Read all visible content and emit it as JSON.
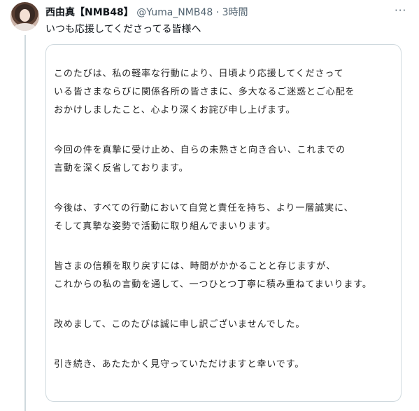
{
  "post": {
    "display_name": "西由真【NMB48】",
    "handle": "@Yuma_NMB48",
    "separator": "·",
    "time": "3時間",
    "text": "いつも応援してくださってる皆様へ",
    "more_icon": "more-horizontal-icon"
  },
  "letter": {
    "paragraphs": [
      [
        "このたびは、私の軽率な行動により、日頃より応援してくださって",
        "いる皆さまならびに関係各所の皆さまに、多大なるご迷惑とご心配を",
        "おかけしましたこと、心より深くお詫び申し上げます。"
      ],
      [
        "今回の件を真摯に受け止め、自らの未熟さと向き合い、これまでの",
        "言動を深く反省しております。"
      ],
      [
        "今後は、すべての行動において自覚と責任を持ち、より一層誠実に、",
        "そして真摯な姿勢で活動に取り組んでまいります。"
      ],
      [
        "皆さまの信頼を取り戻すには、時間がかかることと存じますが、",
        "これからの私の言動を通して、一つひとつ丁寧に積み重ねてまいります。"
      ],
      [
        "改めまして、このたびは誠に申し訳ございませんでした。"
      ],
      [
        "引き続き、あたたかく見守っていただけますと幸いです。"
      ]
    ]
  }
}
